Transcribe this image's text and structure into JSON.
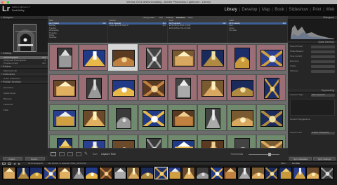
{
  "window": {
    "title": "Vienna 2014 wNew.lrcatalog - Adobe Photoshop Lightroom - Library",
    "lights": [
      "#ff5f57",
      "#ffbd2e",
      "#28c940"
    ]
  },
  "identity": {
    "logo": "Lr",
    "line1": "Adobe Lightroom 5",
    "line2": "Scott Kelby"
  },
  "modules": [
    "Library",
    "Develop",
    "Map",
    "Book",
    "Slideshow",
    "Print",
    "Web"
  ],
  "active_module": "Library",
  "left": {
    "navigator": "Navigator",
    "catalog_header": "Catalog",
    "catalog_items": [
      {
        "label": "All Photographs",
        "count": "412",
        "selected": true
      },
      {
        "label": "All Synced Photographs",
        "count": "0",
        "selected": false
      },
      {
        "label": "Previous Import",
        "count": "412",
        "selected": false
      }
    ],
    "folders_header": "Folders",
    "folder_items": [
      {
        "label": "Macintosh HD",
        "count": ""
      }
    ],
    "collections_header": "Collections",
    "collection_items": [
      {
        "label": "Smart Collections",
        "count": ""
      }
    ],
    "publish_header": "Publish Services",
    "publish_items": [
      {
        "label": "Hard Drive",
        "count": ""
      },
      {
        "label": "Adobe Revel",
        "count": ""
      },
      {
        "label": "Behance",
        "count": ""
      },
      {
        "label": "Facebook",
        "count": ""
      },
      {
        "label": "Flickr",
        "count": ""
      }
    ],
    "import_button": "Import...",
    "export_button": "Export..."
  },
  "filter_bar": {
    "title": "Library Filter :",
    "tabs": [
      "Text",
      "Attribute",
      "Metadata",
      "None"
    ],
    "columns": [
      {
        "header": "Date",
        "rows": [
          {
            "label": "All (4 Dates)",
            "count": "412",
            "sel": true
          },
          {
            "label": "Monday",
            "count": "",
            "sel": false
          },
          {
            "label": "Tuesday",
            "count": "",
            "sel": false
          },
          {
            "label": "Wednesday",
            "count": "",
            "sel": false
          },
          {
            "label": "Thursday",
            "count": "",
            "sel": false
          },
          {
            "label": "Friday",
            "count": "",
            "sel": false
          },
          {
            "label": "Saturday",
            "count": "",
            "sel": false
          }
        ]
      },
      {
        "header": "Camera",
        "rows": [
          {
            "label": "All (1 Camera)",
            "count": "412",
            "sel": true
          },
          {
            "label": "Canon EOS 5D Mark III",
            "count": "412",
            "sel": false
          }
        ]
      },
      {
        "header": "Lens",
        "rows": [
          {
            "label": "All (3 Lenses)",
            "count": "412",
            "sel": true
          },
          {
            "label": "EF16-35mm f/2.8L II USM",
            "count": "",
            "sel": false
          },
          {
            "label": "EF24-105mm f/4L IS USM",
            "count": "",
            "sel": false
          }
        ]
      },
      {
        "header": "Label",
        "rows": [
          {
            "label": "All (4 Labels)",
            "count": "412",
            "sel": true
          },
          {
            "label": "Red",
            "count": "",
            "sel": false
          },
          {
            "label": "Green",
            "count": "",
            "sel": false
          },
          {
            "label": "No Label",
            "count": "",
            "sel": false
          }
        ]
      }
    ]
  },
  "toolbar": {
    "sort_label": "Sort:",
    "sort_value": "Capture Time",
    "thumbnails": "Thumbnails"
  },
  "right": {
    "histogram": "Histogram",
    "quick_develop": "Quick Develop",
    "qd_rows": [
      "Saved Preset",
      "White Balance",
      "Tone Control",
      "Exposure",
      "Clarity",
      "Vibrance"
    ],
    "keywording": "Keywording",
    "keyword_tags": "Keyword Tags",
    "keyword_tags_value": "Enter Keywords",
    "keyword_suggestions": "Keyword Suggestions",
    "keyword_set": "Keyword Set",
    "keyword_set_value": "Outdoor Photography",
    "sync_metadata": "Sync Metadata",
    "sync_settings": "Sync Settings"
  },
  "filmstrip": {
    "label": "All Photographs",
    "info": "412 photos / 1 selected / IMG_4470.CR2",
    "filter": "Filter :",
    "filter_value": "No Filter"
  },
  "colors": {
    "pink": "#9a6e74",
    "green": "#708a6e",
    "gray": "#808080",
    "selected": "#d7d7d7",
    "accent": "#3d5f95"
  }
}
